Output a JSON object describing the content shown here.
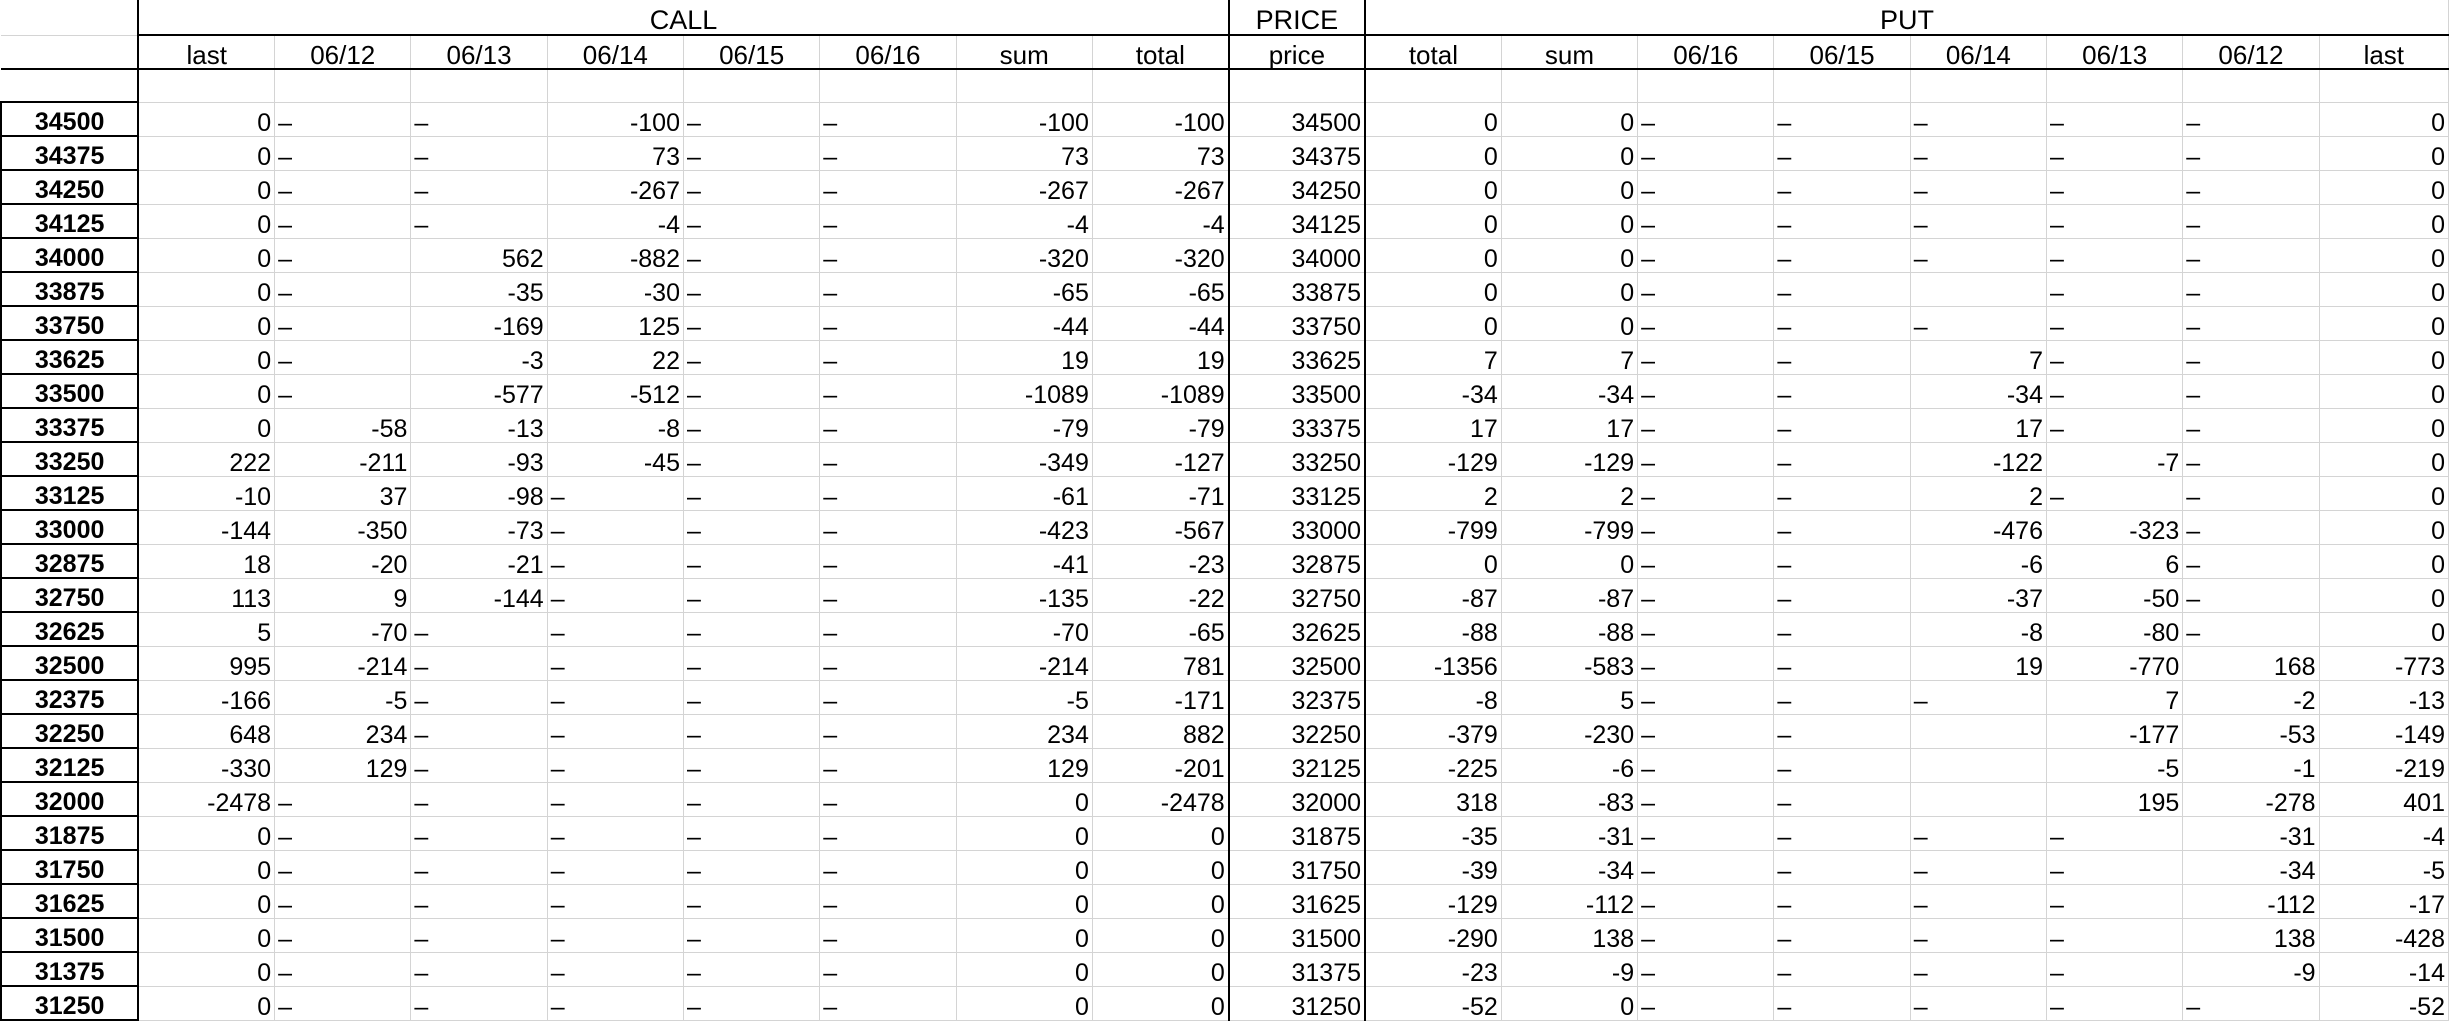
{
  "sheet": {
    "groups": {
      "call": "CALL",
      "price": "PRICE",
      "put": "PUT"
    },
    "headers": [
      "last",
      "06/12",
      "06/13",
      "06/14",
      "06/15",
      "06/16",
      "sum",
      "total",
      "price",
      "total",
      "sum",
      "06/16",
      "06/15",
      "06/14",
      "06/13",
      "06/12",
      "last"
    ],
    "rows": [
      {
        "label": "34500",
        "cells": [
          "0",
          "–",
          "–",
          "-100",
          "–",
          "–",
          "-100",
          "-100",
          "34500",
          "0",
          "0",
          "–",
          "–",
          "–",
          "–",
          "–",
          "0"
        ]
      },
      {
        "label": "34375",
        "cells": [
          "0",
          "–",
          "–",
          "73",
          "–",
          "–",
          "73",
          "73",
          "34375",
          "0",
          "0",
          "–",
          "–",
          "–",
          "–",
          "–",
          "0"
        ]
      },
      {
        "label": "34250",
        "cells": [
          "0",
          "–",
          "–",
          "-267",
          "–",
          "–",
          "-267",
          "-267",
          "34250",
          "0",
          "0",
          "–",
          "–",
          "–",
          "–",
          "–",
          "0"
        ]
      },
      {
        "label": "34125",
        "cells": [
          "0",
          "–",
          "–",
          "-4",
          "–",
          "–",
          "-4",
          "-4",
          "34125",
          "0",
          "0",
          "–",
          "–",
          "–",
          "–",
          "–",
          "0"
        ]
      },
      {
        "label": "34000",
        "cells": [
          "0",
          "–",
          "562",
          "-882",
          "–",
          "–",
          "-320",
          "-320",
          "34000",
          "0",
          "0",
          "–",
          "–",
          "–",
          "–",
          "–",
          "0"
        ]
      },
      {
        "label": "33875",
        "cells": [
          "0",
          "–",
          "-35",
          "-30",
          "–",
          "–",
          "-65",
          "-65",
          "33875",
          "0",
          "0",
          "–",
          "–",
          "",
          "–",
          "–",
          "0"
        ]
      },
      {
        "label": "33750",
        "cells": [
          "0",
          "–",
          "-169",
          "125",
          "–",
          "–",
          "-44",
          "-44",
          "33750",
          "0",
          "0",
          "–",
          "–",
          "–",
          "–",
          "–",
          "0"
        ]
      },
      {
        "label": "33625",
        "cells": [
          "0",
          "–",
          "-3",
          "22",
          "–",
          "–",
          "19",
          "19",
          "33625",
          "7",
          "7",
          "–",
          "–",
          "7",
          "–",
          "–",
          "0"
        ]
      },
      {
        "label": "33500",
        "cells": [
          "0",
          "–",
          "-577",
          "-512",
          "–",
          "–",
          "-1089",
          "-1089",
          "33500",
          "-34",
          "-34",
          "–",
          "–",
          "-34",
          "–",
          "–",
          "0"
        ]
      },
      {
        "label": "33375",
        "cells": [
          "0",
          "-58",
          "-13",
          "-8",
          "–",
          "–",
          "-79",
          "-79",
          "33375",
          "17",
          "17",
          "–",
          "–",
          "17",
          "–",
          "–",
          "0"
        ]
      },
      {
        "label": "33250",
        "cells": [
          "222",
          "-211",
          "-93",
          "-45",
          "–",
          "–",
          "-349",
          "-127",
          "33250",
          "-129",
          "-129",
          "–",
          "–",
          "-122",
          "-7",
          "–",
          "0"
        ]
      },
      {
        "label": "33125",
        "cells": [
          "-10",
          "37",
          "-98",
          "–",
          "–",
          "–",
          "-61",
          "-71",
          "33125",
          "2",
          "2",
          "–",
          "–",
          "2",
          "–",
          "–",
          "0"
        ]
      },
      {
        "label": "33000",
        "cells": [
          "-144",
          "-350",
          "-73",
          "–",
          "–",
          "–",
          "-423",
          "-567",
          "33000",
          "-799",
          "-799",
          "–",
          "–",
          "-476",
          "-323",
          "–",
          "0"
        ]
      },
      {
        "label": "32875",
        "cells": [
          "18",
          "-20",
          "-21",
          "–",
          "–",
          "–",
          "-41",
          "-23",
          "32875",
          "0",
          "0",
          "–",
          "–",
          "-6",
          "6",
          "–",
          "0"
        ]
      },
      {
        "label": "32750",
        "cells": [
          "113",
          "9",
          "-144",
          "–",
          "–",
          "–",
          "-135",
          "-22",
          "32750",
          "-87",
          "-87",
          "–",
          "–",
          "-37",
          "-50",
          "–",
          "0"
        ]
      },
      {
        "label": "32625",
        "cells": [
          "5",
          "-70",
          "–",
          "–",
          "–",
          "–",
          "-70",
          "-65",
          "32625",
          "-88",
          "-88",
          "–",
          "–",
          "-8",
          "-80",
          "–",
          "0"
        ]
      },
      {
        "label": "32500",
        "cells": [
          "995",
          "-214",
          "–",
          "–",
          "–",
          "–",
          "-214",
          "781",
          "32500",
          "-1356",
          "-583",
          "–",
          "–",
          "19",
          "-770",
          "168",
          "-773"
        ]
      },
      {
        "label": "32375",
        "cells": [
          "-166",
          "-5",
          "–",
          "–",
          "–",
          "–",
          "-5",
          "-171",
          "32375",
          "-8",
          "5",
          "–",
          "–",
          "–",
          "7",
          "-2",
          "-13"
        ]
      },
      {
        "label": "32250",
        "cells": [
          "648",
          "234",
          "–",
          "–",
          "–",
          "–",
          "234",
          "882",
          "32250",
          "-379",
          "-230",
          "–",
          "–",
          "",
          "-177",
          "-53",
          "-149"
        ]
      },
      {
        "label": "32125",
        "cells": [
          "-330",
          "129",
          "–",
          "–",
          "–",
          "–",
          "129",
          "-201",
          "32125",
          "-225",
          "-6",
          "–",
          "–",
          "",
          "-5",
          "-1",
          "-219"
        ]
      },
      {
        "label": "32000",
        "cells": [
          "-2478",
          "–",
          "–",
          "–",
          "–",
          "–",
          "0",
          "-2478",
          "32000",
          "318",
          "-83",
          "–",
          "–",
          "",
          "195",
          "-278",
          "401"
        ]
      },
      {
        "label": "31875",
        "cells": [
          "0",
          "–",
          "–",
          "–",
          "–",
          "–",
          "0",
          "0",
          "31875",
          "-35",
          "-31",
          "–",
          "–",
          "–",
          "–",
          "-31",
          "-4"
        ]
      },
      {
        "label": "31750",
        "cells": [
          "0",
          "–",
          "–",
          "–",
          "–",
          "–",
          "0",
          "0",
          "31750",
          "-39",
          "-34",
          "–",
          "–",
          "–",
          "–",
          "-34",
          "-5"
        ]
      },
      {
        "label": "31625",
        "cells": [
          "0",
          "–",
          "–",
          "–",
          "–",
          "–",
          "0",
          "0",
          "31625",
          "-129",
          "-112",
          "–",
          "–",
          "–",
          "–",
          "-112",
          "-17"
        ]
      },
      {
        "label": "31500",
        "cells": [
          "0",
          "–",
          "–",
          "–",
          "–",
          "–",
          "0",
          "0",
          "31500",
          "-290",
          "138",
          "–",
          "–",
          "–",
          "–",
          "138",
          "-428"
        ]
      },
      {
        "label": "31375",
        "cells": [
          "0",
          "–",
          "–",
          "–",
          "–",
          "–",
          "0",
          "0",
          "31375",
          "-23",
          "-9",
          "–",
          "–",
          "–",
          "–",
          "-9",
          "-14"
        ]
      },
      {
        "label": "31250",
        "cells": [
          "0",
          "–",
          "–",
          "–",
          "–",
          "–",
          "0",
          "0",
          "31250",
          "-52",
          "0",
          "–",
          "–",
          "–",
          "–",
          "–",
          "-52"
        ]
      }
    ]
  }
}
